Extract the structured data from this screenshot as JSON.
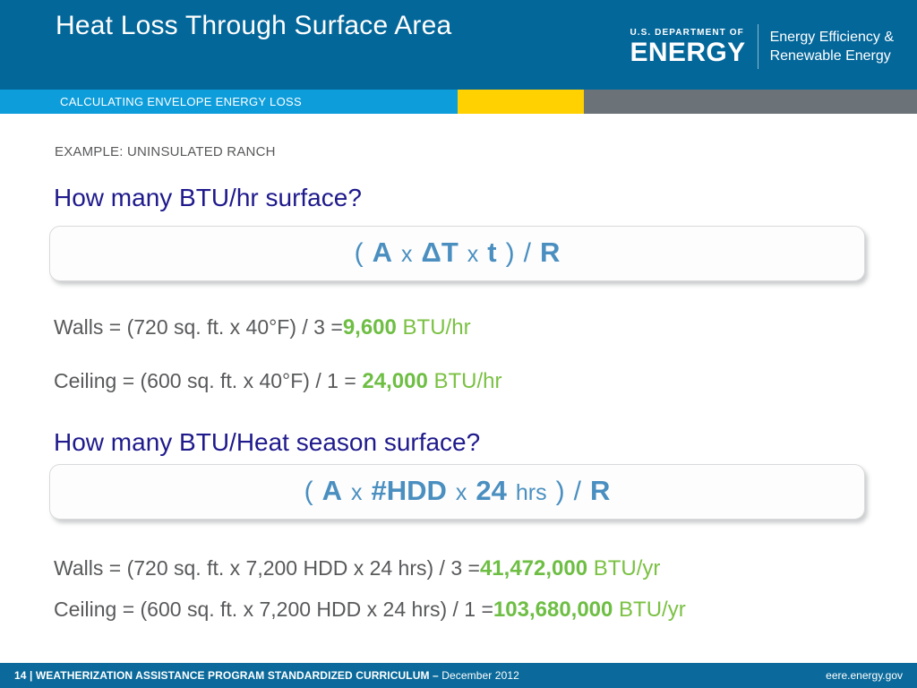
{
  "header": {
    "title": "Heat Loss Through Surface Area",
    "logo": {
      "dept_line": "U.S. DEPARTMENT OF",
      "energy_word": "ENERGY",
      "tagline_line1": "Energy Efficiency &",
      "tagline_line2": "Renewable Energy"
    },
    "background_color": "#04679a"
  },
  "accent_bar": {
    "subtitle": "CALCULATING ENVELOPE ENERGY LOSS",
    "blue_color": "#0d9ddb",
    "yellow_color": "#ffd100",
    "gray_color": "#6b7378"
  },
  "body": {
    "eyebrow": "EXAMPLE: UNINSULATED RANCH",
    "heading_color": "#1f1a8c",
    "formula_color": "#4a8fc0",
    "result_color": "#6ebe44",
    "sections": [
      {
        "heading": "How many BTU/hr surface?",
        "formula": {
          "open_paren": "(",
          "term1": "A",
          "op1": "x",
          "term2": "ΔT",
          "op2": "x",
          "term3": "t",
          "close_paren": ")",
          "divider": "/",
          "term4": "R"
        },
        "calculations": [
          {
            "expression": "Walls = (720 sq. ft. x 40°F) / 3 =",
            "result": "9,600",
            "unit": "BTU/hr"
          },
          {
            "expression": "Ceiling = (600 sq. ft. x 40°F) / 1 =",
            "result": "24,000",
            "unit": "BTU/hr"
          }
        ]
      },
      {
        "heading": "How many BTU/Heat season surface?",
        "formula": {
          "open_paren": "(",
          "term1": "A",
          "op1": "x",
          "term2": "#HDD",
          "op2": "x",
          "term3": "24",
          "term3_unit": "hrs",
          "close_paren": ")",
          "divider": "/",
          "term4": "R"
        },
        "calculations": [
          {
            "expression": "Walls = (720 sq. ft. x 7,200 HDD x 24 hrs) / 3 =",
            "result": "41,472,000",
            "unit": "BTU/yr"
          },
          {
            "expression": "Ceiling = (600 sq. ft. x 7,200 HDD x 24 hrs) / 1 =",
            "result": "103,680,000",
            "unit": "BTU/yr"
          }
        ]
      }
    ]
  },
  "footer": {
    "page_and_program": "14 | WEATHERIZATION ASSISTANCE PROGRAM STANDARDIZED CURRICULUM – ",
    "date": "December 2012",
    "website": "eere.energy.gov",
    "background_color": "#0b6a9b"
  }
}
